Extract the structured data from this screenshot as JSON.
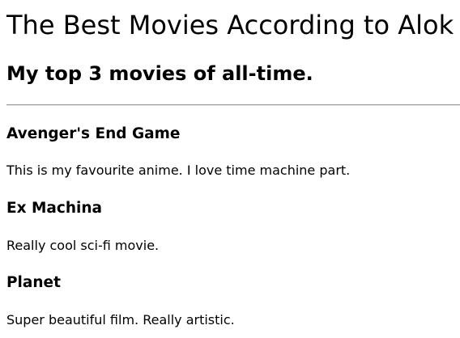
{
  "page": {
    "title": "The Best Movies According to Alok",
    "subtitle": "My top 3 movies of all-time."
  },
  "movies": [
    {
      "title": "Avenger's End Game",
      "description": "This is my favourite anime. I love time machine part."
    },
    {
      "title": "Ex Machina",
      "description": "Really cool sci-fi movie."
    },
    {
      "title": "Planet",
      "description": "Super beautiful film. Really artistic."
    }
  ]
}
